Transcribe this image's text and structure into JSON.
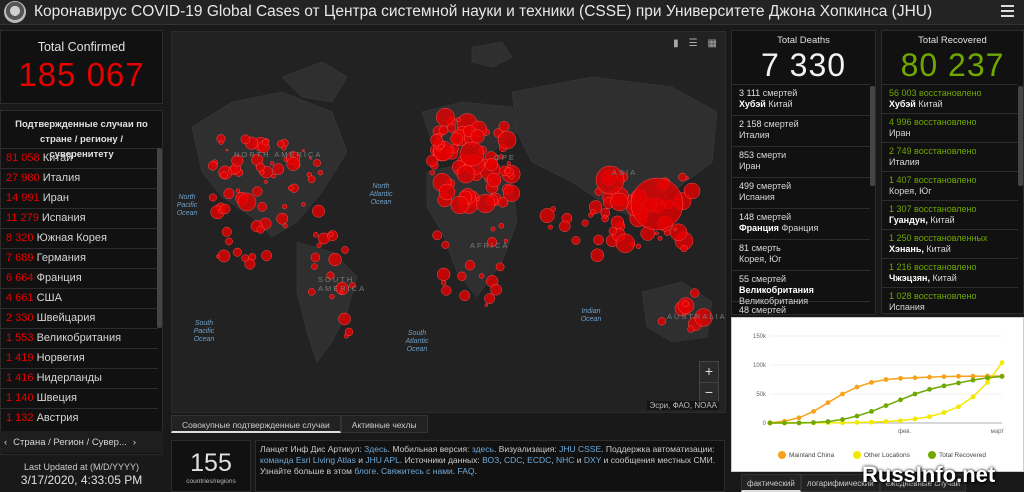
{
  "header": {
    "title": "Коронавирус COVID-19 Global Cases от Центра системной науки и техники (CSSE) при Университете Джона Хопкинса (JHU)"
  },
  "total_confirmed": {
    "label": "Total Confirmed",
    "value": "185 067"
  },
  "country_panel": {
    "title": "Подтвержденные случаи по стране / региону / суверенитету",
    "rows": [
      {
        "count": "81 058",
        "country": "Китай"
      },
      {
        "count": "27 980",
        "country": "Италия"
      },
      {
        "count": "14 991",
        "country": "Иран"
      },
      {
        "count": "11 279",
        "country": "Испания"
      },
      {
        "count": "8 320",
        "country": "Южная Корея"
      },
      {
        "count": "7 689",
        "country": "Германия"
      },
      {
        "count": "6 664",
        "country": "Франция"
      },
      {
        "count": "4 661",
        "country": "США"
      },
      {
        "count": "2 330",
        "country": "Швейцария"
      },
      {
        "count": "1 553",
        "country": "Великобритания"
      },
      {
        "count": "1 419",
        "country": "Норвегия"
      },
      {
        "count": "1 416",
        "country": "Нидерланды"
      },
      {
        "count": "1 140",
        "country": "Швеция"
      },
      {
        "count": "1 132",
        "country": "Австрия"
      }
    ],
    "footer": "Страна / Регион / Сувер..."
  },
  "last_updated": {
    "label": "Last Updated at (M/D/YYYY)",
    "value": "3/17/2020, 4:33:05 PM"
  },
  "map": {
    "oceans": {
      "north_pacific": "North Pacific Ocean",
      "north_atlantic": "North Atlantic Ocean",
      "south_pacific": "South Pacific Ocean",
      "south_atlantic": "South Atlantic Ocean",
      "indian": "Indian Ocean"
    },
    "continents": {
      "north_america": "NORTH AMERICA",
      "south_america": "SOUTH AMERICA",
      "africa": "AFRICA",
      "asia": "ASIA",
      "australia": "AUSTRALIA",
      "europe": "OPE"
    },
    "zoom_in": "+",
    "zoom_out": "−",
    "attribution": "Эсри, ФАО, NOAA",
    "bubble_color": "#e60000"
  },
  "map_tabs": [
    "Совокупные подтвержденные случаи",
    "Активные чехлы"
  ],
  "countries": {
    "value": "155",
    "label": "countries/regions"
  },
  "info": {
    "p1": "Ланцет Инф Дис Артикул: ",
    "l1": "Здесь",
    "p2": ". Мобильная версия: ",
    "l2": "здесь",
    "p3": ". Визуализация: ",
    "l3": "JHU CSSE",
    "p4": ". Поддержка автоматизации: ",
    "l4": "команда Esri Living Atlas",
    "p5": " и ",
    "l5": "JHU APL",
    "p6": ". Источники данных: ",
    "l6": "ВОЗ",
    "p7": ", ",
    "l7": "CDC",
    "p8": ", ",
    "l8": "ECDC",
    "p9": ", ",
    "l9": "NHC",
    "p10": " и ",
    "l10": "DXY",
    "p11": " и сообщения местных СМИ. Узнайте больше в этом ",
    "l11": "блоге",
    "p12": ". ",
    "l12": "Свяжитесь с нами",
    "p13": ". ",
    "l13": "FAQ",
    "p14": "."
  },
  "deaths": {
    "label": "Total Deaths",
    "value": "7 330",
    "rows": [
      {
        "count": "3 111",
        "unit": "смертей",
        "bold": "Хубэй",
        "rest": "Китай"
      },
      {
        "count": "2 158",
        "unit": "смертей",
        "bold": "",
        "rest": "Италия"
      },
      {
        "count": "853",
        "unit": "смерти",
        "bold": "",
        "rest": "Иран"
      },
      {
        "count": "499",
        "unit": "смертей",
        "bold": "",
        "rest": "Испания"
      },
      {
        "count": "148",
        "unit": "смертей",
        "bold": "Франция",
        "rest": "Франция"
      },
      {
        "count": "81",
        "unit": "смерть",
        "bold": "",
        "rest": "Корея, Юг"
      },
      {
        "count": "55",
        "unit": "смертей",
        "bold": "Великобритания",
        "rest": "Великобритания"
      },
      {
        "count": "48",
        "unit": "смертей",
        "bold": "",
        "rest": ""
      }
    ]
  },
  "recovered": {
    "label": "Total Recovered",
    "value": "80 237",
    "rows": [
      {
        "count": "56 003",
        "unit": "восстановлено",
        "bold": "Хубэй",
        "rest": "Китай"
      },
      {
        "count": "4 996",
        "unit": "восстановлено",
        "bold": "",
        "rest": "Иран"
      },
      {
        "count": "2 749",
        "unit": "восстановлено",
        "bold": "",
        "rest": "Италия"
      },
      {
        "count": "1 407",
        "unit": "восстановлено",
        "bold": "",
        "rest": "Корея, Юг"
      },
      {
        "count": "1 307",
        "unit": "восстановлено",
        "bold": "Гуандун,",
        "rest": "Китай"
      },
      {
        "count": "1 250",
        "unit": "восстановленных",
        "bold": "Хэнань,",
        "rest": "Китай"
      },
      {
        "count": "1 216",
        "unit": "восстановлено",
        "bold": "Чжэцзян,",
        "rest": "Китай"
      },
      {
        "count": "1 028",
        "unit": "восстановлено",
        "bold": "",
        "rest": "Испания"
      }
    ]
  },
  "chart_data": {
    "type": "line",
    "x": [
      "фев.",
      "март"
    ],
    "ylim": [
      0,
      150000
    ],
    "yticks": [
      "0",
      "50k",
      "100k",
      "150k"
    ],
    "series": [
      {
        "name": "Mainland China",
        "color": "#f7a21b",
        "values": [
          500,
          3000,
          9000,
          20000,
          35000,
          50000,
          62000,
          70000,
          75000,
          77000,
          78000,
          79000,
          80000,
          80500,
          80700,
          80900,
          81000
        ]
      },
      {
        "name": "Other Locations",
        "color": "#f2e800",
        "values": [
          0,
          100,
          200,
          300,
          400,
          600,
          900,
          1500,
          2500,
          4000,
          7000,
          11000,
          18000,
          28000,
          45000,
          70000,
          104000
        ]
      },
      {
        "name": "Total Recovered",
        "color": "#70a800",
        "values": [
          0,
          50,
          200,
          800,
          2500,
          6000,
          12000,
          20000,
          30000,
          40000,
          50000,
          58000,
          64000,
          69000,
          74000,
          78000,
          80237
        ]
      }
    ]
  },
  "chart_tabs": [
    "фактический",
    "логарифмический",
    "ежедневные случаи"
  ],
  "watermark": "RussInfo.net"
}
